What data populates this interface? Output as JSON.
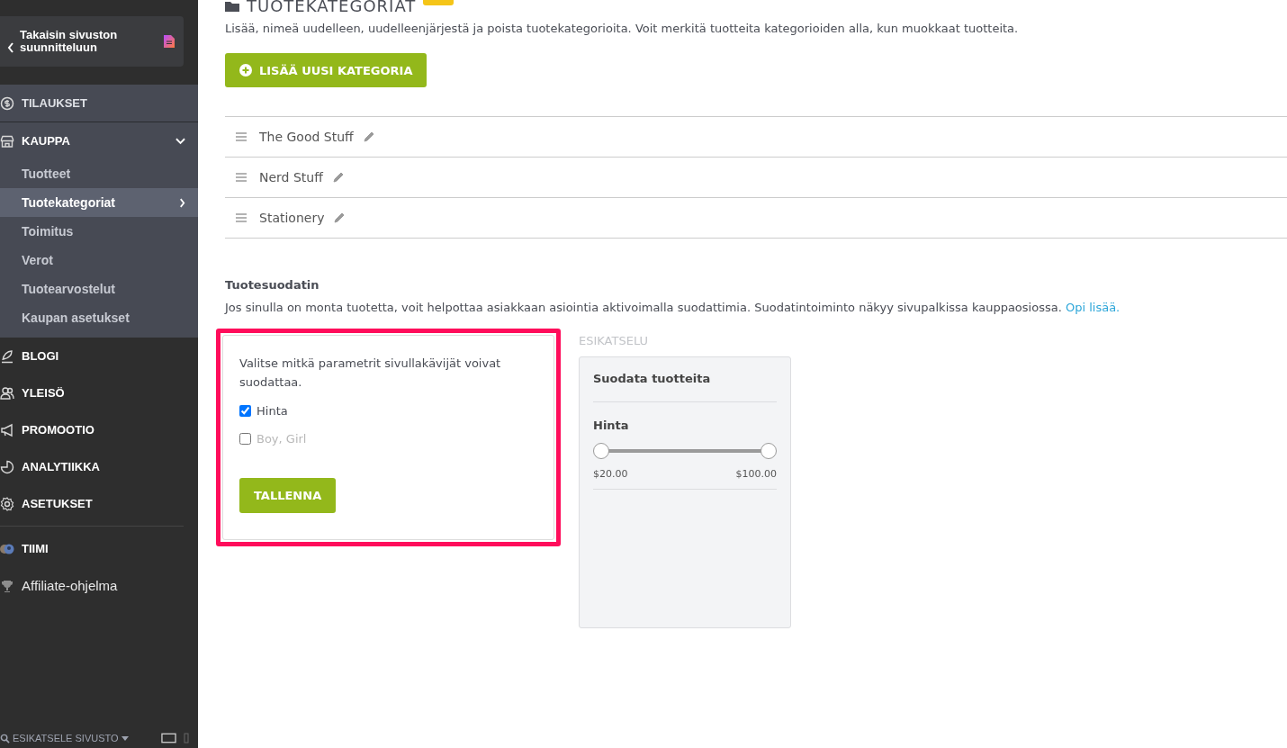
{
  "sidebar": {
    "back_button": {
      "label": "Takaisin sivuston suunnitteluun"
    },
    "items": [
      {
        "kind": "panel",
        "label": "TILAUKSET",
        "expanded": false
      },
      {
        "kind": "panel",
        "label": "KAUPPA",
        "expanded": true,
        "children": [
          {
            "label": "Tuotteet",
            "selected": false
          },
          {
            "label": "Tuotekategoriat",
            "selected": true
          },
          {
            "label": "Toimitus",
            "selected": false
          },
          {
            "label": "Verot",
            "selected": false
          },
          {
            "label": "Tuotearvostelut",
            "selected": false
          },
          {
            "label": "Kaupan asetukset",
            "selected": false
          }
        ]
      },
      {
        "kind": "section",
        "label": "BLOGI"
      },
      {
        "kind": "section",
        "label": "YLEISÖ"
      },
      {
        "kind": "section",
        "label": "PROMOOTIO"
      },
      {
        "kind": "section",
        "label": "ANALYTIIKKA"
      },
      {
        "kind": "section",
        "label": "ASETUKSET"
      },
      {
        "kind": "divider"
      },
      {
        "kind": "section",
        "label": "TIIMI"
      },
      {
        "kind": "link",
        "label": "Affiliate-ohjelma"
      }
    ],
    "footer": {
      "preview_label": "ESIKATSELE SIVUSTO"
    }
  },
  "page": {
    "title": "TUOTEKATEGORIAT",
    "description": "Lisää, nimeä uudelleen, uudelleenjärjestä ja poista tuotekategorioita. Voit merkitä tuotteita kategorioiden alla, kun muokkaat tuotteita.",
    "add_button": "LISÄÄ UUSI KATEGORIA",
    "categories": [
      "The Good Stuff",
      "Nerd Stuff",
      "Stationery"
    ],
    "filter": {
      "title": "Tuotesuodatin",
      "description": "Jos sinulla on monta tuotetta, voit helpottaa asiakkaan asiointia aktivoimalla suodattimia. Suodatintoiminto näkyy sivupalkissa kauppaosiossa.",
      "link": "Opi lisää.",
      "prompt": "Valitse mitkä parametrit sivullakävijät voivat suodattaa.",
      "options": [
        {
          "label": "Hinta",
          "checked": true
        },
        {
          "label": "Boy, Girl",
          "checked": false
        }
      ],
      "save_button": "TALLENNA",
      "highlighted": true
    },
    "preview": {
      "label": "ESIKATSELU",
      "title": "Suodata tuotteita",
      "price_label": "Hinta",
      "range_min": "$20.00",
      "range_max": "$100.00",
      "thumbs": [
        {
          "level": 0
        },
        {
          "level": 1
        }
      ]
    }
  }
}
